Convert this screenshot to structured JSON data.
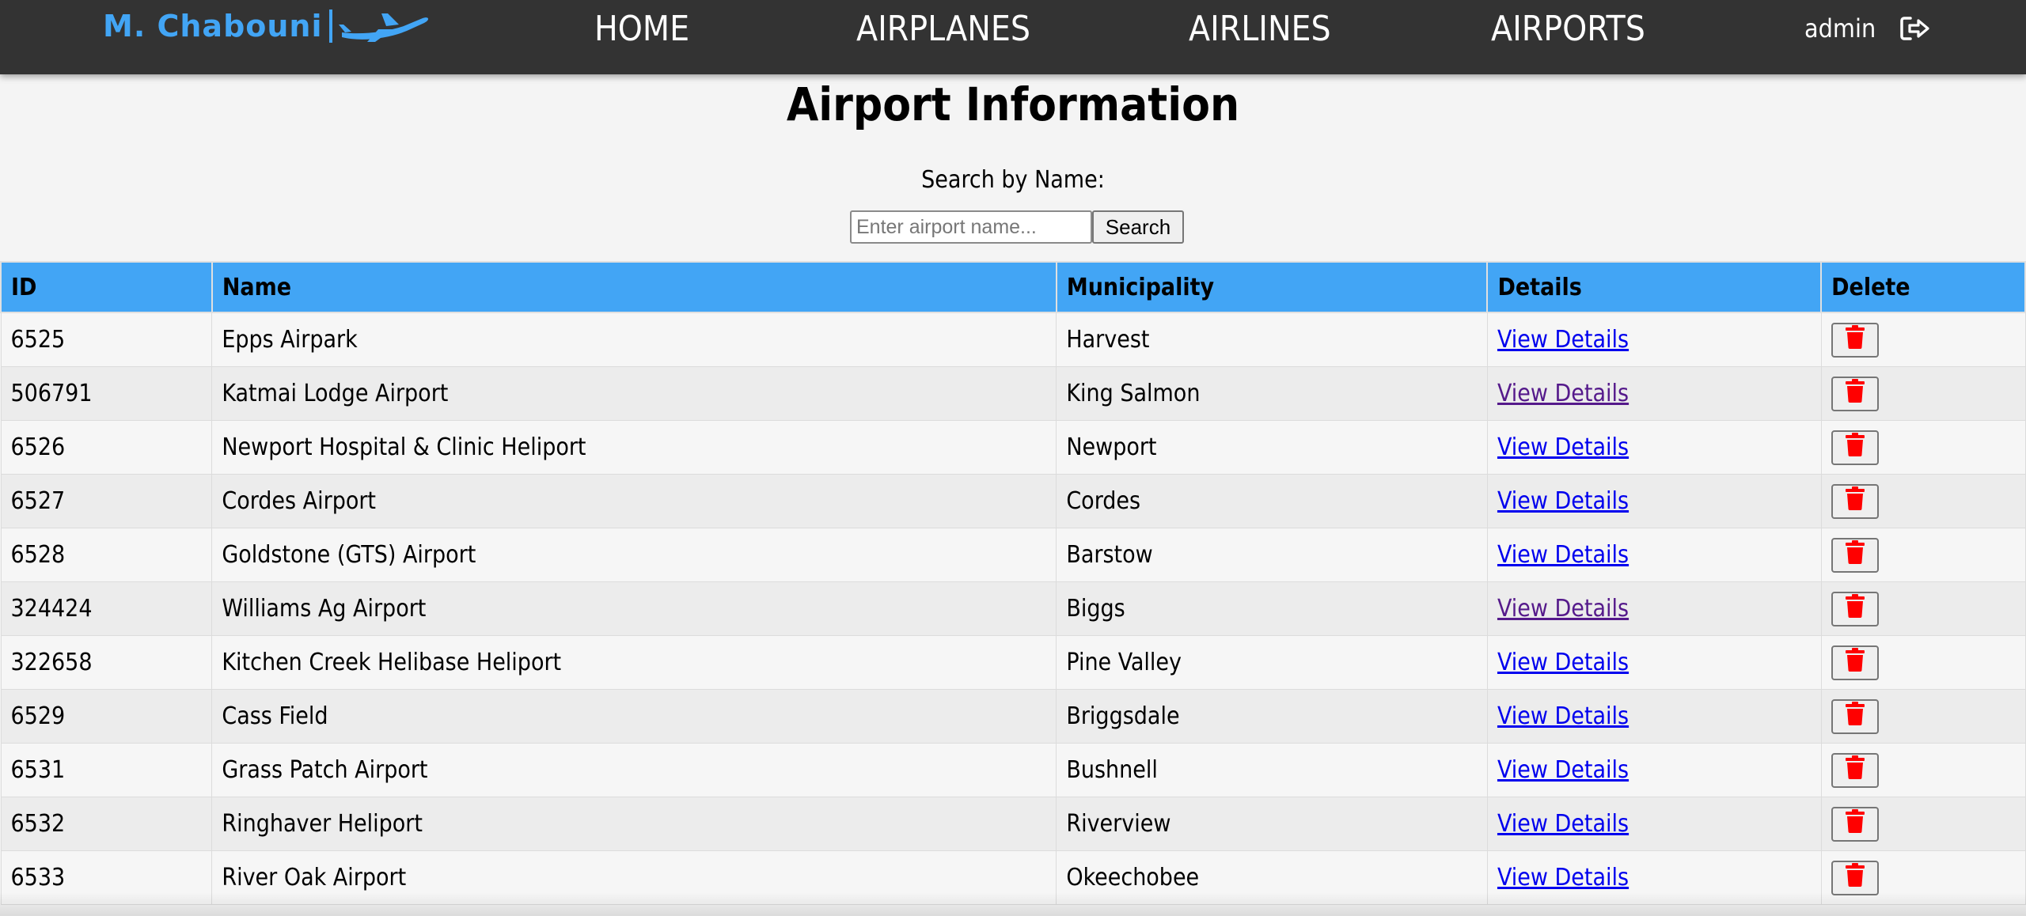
{
  "navbar": {
    "brand": "M. Chabouni",
    "links": [
      "HOME",
      "AIRPLANES",
      "AIRLINES",
      "AIRPORTS"
    ],
    "user": "admin",
    "icons": {
      "brand": "airplane-icon",
      "logout": "logout-icon"
    },
    "background_color": "#333333",
    "brand_color": "#42a5f5"
  },
  "page": {
    "title": "Airport Information",
    "search_label": "Search by Name:",
    "search_placeholder": "Enter airport name...",
    "search_button": "Search"
  },
  "table": {
    "header_color": "#42a5f5",
    "columns": [
      "ID",
      "Name",
      "Municipality",
      "Details",
      "Delete"
    ],
    "details_label": "View Details",
    "delete_icon": "trash-icon",
    "delete_icon_color": "#ff0000",
    "rows": [
      {
        "id": "6525",
        "name": "Epps Airpark",
        "municipality": "Harvest",
        "details_visited": false
      },
      {
        "id": "506791",
        "name": "Katmai Lodge Airport",
        "municipality": "King Salmon",
        "details_visited": true
      },
      {
        "id": "6526",
        "name": "Newport Hospital & Clinic Heliport",
        "municipality": "Newport",
        "details_visited": false
      },
      {
        "id": "6527",
        "name": "Cordes Airport",
        "municipality": "Cordes",
        "details_visited": false
      },
      {
        "id": "6528",
        "name": "Goldstone (GTS) Airport",
        "municipality": "Barstow",
        "details_visited": false
      },
      {
        "id": "324424",
        "name": "Williams Ag Airport",
        "municipality": "Biggs",
        "details_visited": true
      },
      {
        "id": "322658",
        "name": "Kitchen Creek Helibase Heliport",
        "municipality": "Pine Valley",
        "details_visited": false
      },
      {
        "id": "6529",
        "name": "Cass Field",
        "municipality": "Briggsdale",
        "details_visited": false
      },
      {
        "id": "6531",
        "name": "Grass Patch Airport",
        "municipality": "Bushnell",
        "details_visited": false
      },
      {
        "id": "6532",
        "name": "Ringhaver Heliport",
        "municipality": "Riverview",
        "details_visited": false
      },
      {
        "id": "6533",
        "name": "River Oak Airport",
        "municipality": "Okeechobee",
        "details_visited": false
      }
    ]
  }
}
